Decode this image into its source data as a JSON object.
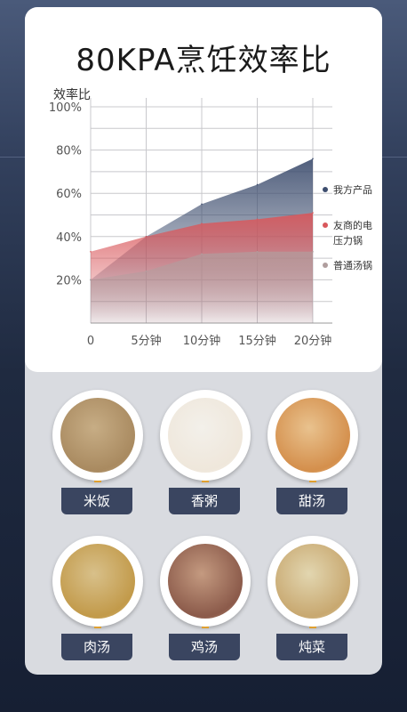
{
  "title": "80KPA烹饪效率比",
  "chart_data": {
    "type": "area",
    "ylabel": "效率比",
    "x": [
      "0",
      "5分钟",
      "10分钟",
      "15分钟",
      "20分钟"
    ],
    "y_ticks": [
      "20%",
      "40%",
      "60%",
      "80%",
      "100%"
    ],
    "ylim": [
      0,
      100
    ],
    "grid": true,
    "legend_position": "right",
    "series": [
      {
        "name": "我方产品",
        "color": "#3d4d6e",
        "values": [
          20,
          40,
          55,
          64,
          76
        ]
      },
      {
        "name": "友商的电压力锅",
        "color": "#d9585c",
        "values": [
          33,
          40,
          46,
          48,
          51
        ]
      },
      {
        "name": "普通汤锅",
        "color": "#b09e9e",
        "values": [
          20,
          24,
          32,
          33,
          33
        ]
      }
    ]
  },
  "foods": [
    {
      "label": "米饭",
      "color": "#a98a60",
      "rim": "#c7ad85"
    },
    {
      "label": "香粥",
      "color": "#efe7db",
      "rim": "#f3f0ea"
    },
    {
      "label": "甜汤",
      "color": "#d48f4c",
      "rim": "#e9c28e"
    },
    {
      "label": "肉汤",
      "color": "#c29a4a",
      "rim": "#d8c08a"
    },
    {
      "label": "鸡汤",
      "color": "#8b5a4a",
      "rim": "#c49a80"
    },
    {
      "label": "炖菜",
      "color": "#c8a870",
      "rim": "#e2d6b0"
    }
  ]
}
